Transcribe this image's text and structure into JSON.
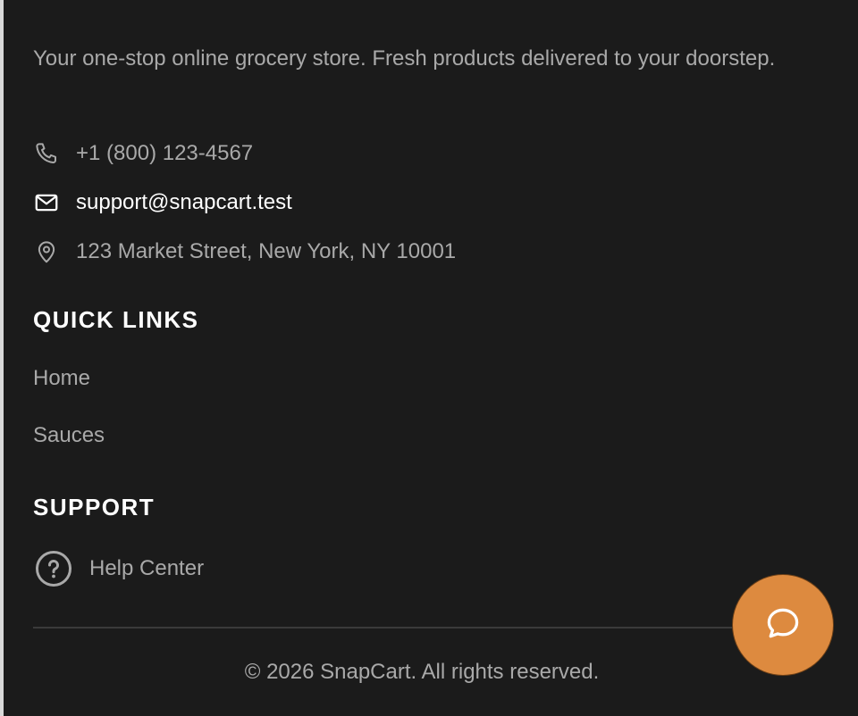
{
  "footer": {
    "about_text": "Your one-stop online grocery store. Fresh products delivered to your doorstep.",
    "contact": {
      "phone": "+1 (800) 123-4567",
      "email": "support@snapcart.test",
      "address": "123 Market Street, New York, NY 10001"
    },
    "quick_links": {
      "heading": "QUICK LINKS",
      "items": [
        {
          "label": "Home"
        },
        {
          "label": "Sauces"
        }
      ]
    },
    "support": {
      "heading": "SUPPORT",
      "items": [
        {
          "label": "Help Center",
          "icon": "question-circle-icon"
        }
      ]
    },
    "copyright": "© 2026 SnapCart. All rights reserved."
  },
  "chat": {
    "icon": "chat-bubble-icon",
    "color": "#dd8a3f"
  },
  "colors": {
    "background": "#1b1b1b",
    "text_muted": "#a9a9a9",
    "text_bright": "#ffffff"
  }
}
